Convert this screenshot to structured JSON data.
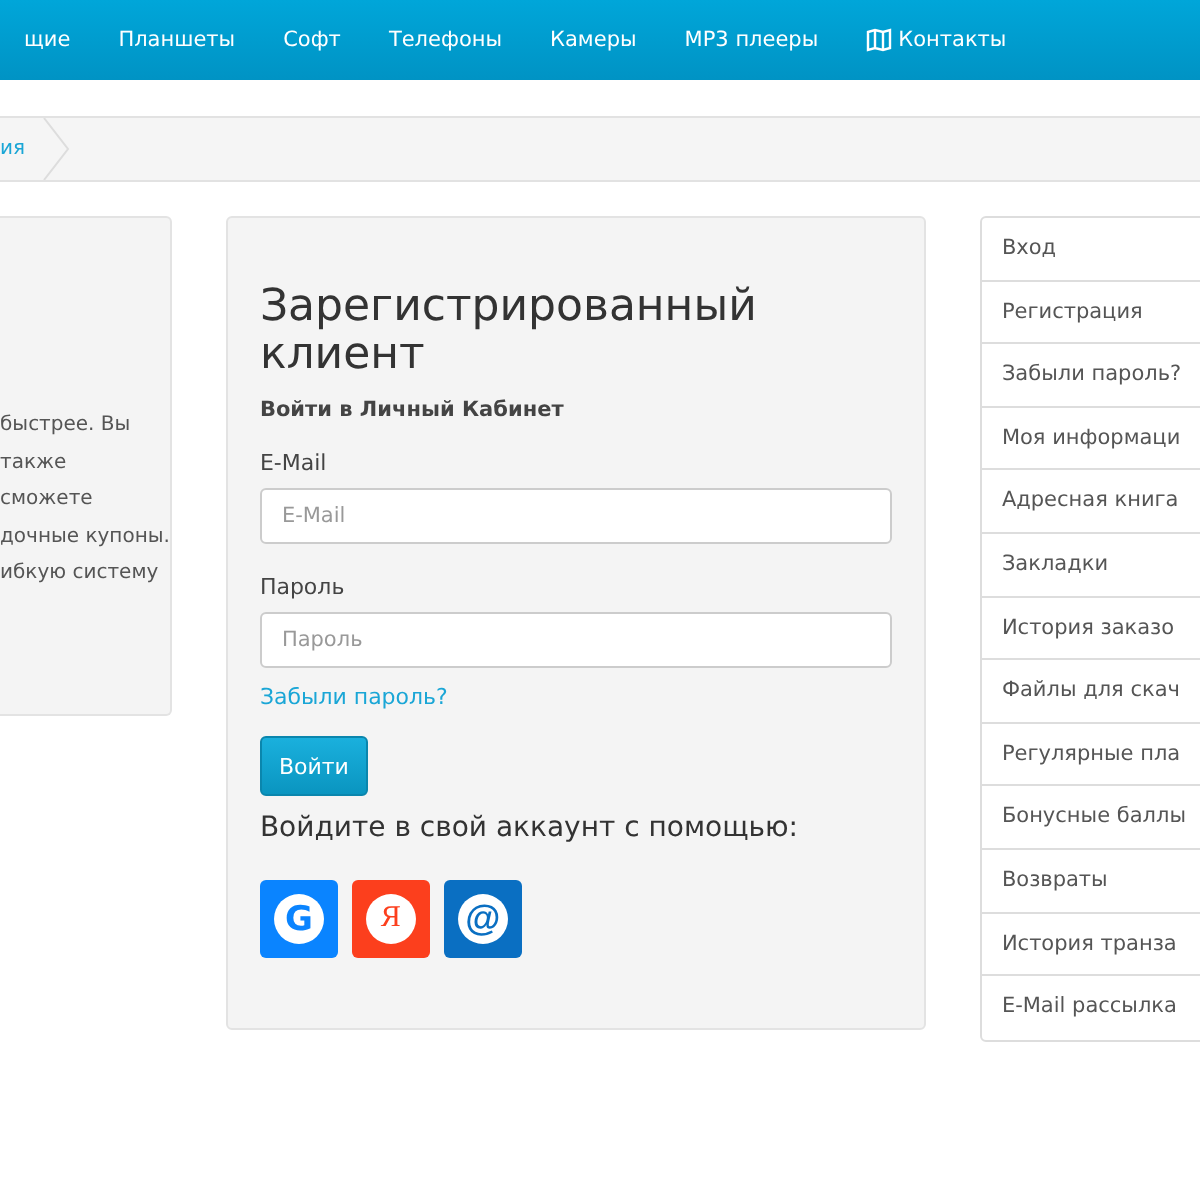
{
  "nav": {
    "items": [
      {
        "label": "щие",
        "icon": false
      },
      {
        "label": "Планшеты",
        "icon": false
      },
      {
        "label": "Софт",
        "icon": false
      },
      {
        "label": "Телефоны",
        "icon": false
      },
      {
        "label": "Камеры",
        "icon": false
      },
      {
        "label": "MP3 плееры",
        "icon": false
      },
      {
        "label": "Контакты",
        "icon": true
      }
    ]
  },
  "breadcrumb": {
    "items": [
      "ия"
    ]
  },
  "left_panel": {
    "lines": [
      "быстрее. Вы",
      "также",
      "сможете",
      "дочные купоны.",
      "ибкую систему"
    ]
  },
  "login": {
    "title": "Зарегистрированный клиент",
    "subtitle": "Войти в Личный Кабинет",
    "fields": [
      {
        "label": "E-Mail",
        "placeholder": "E-Mail"
      },
      {
        "label": "Пароль",
        "placeholder": "Пароль"
      }
    ],
    "forgot_link": "Забыли пароль?",
    "submit": "Войти",
    "social_prompt": "Войдите в свой аккаунт с помощью:",
    "social": [
      {
        "kind": "google",
        "glyph": "G",
        "color": "#0a84ff"
      },
      {
        "kind": "yandex",
        "glyph": "Я",
        "color": "#fc3f1d"
      },
      {
        "kind": "mailru",
        "glyph": "@",
        "color": "#0a6fc2"
      }
    ]
  },
  "account_menu": {
    "items": [
      "Вход",
      "Регистрация",
      "Забыли пароль?",
      "Моя информаци",
      "Адресная книга",
      "Закладки",
      "История заказо",
      "Файлы для скач",
      "Регулярные пла",
      "Бонусные баллы",
      "Возвраты",
      "История транза",
      "E-Mail рассылка"
    ]
  }
}
